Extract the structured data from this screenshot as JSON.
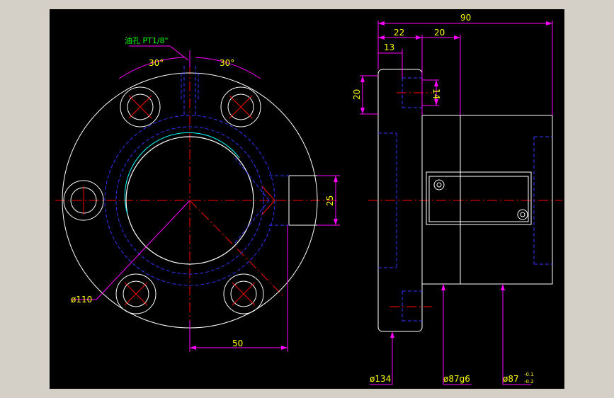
{
  "colors": {
    "background": "#d4d0c8",
    "canvas": "#000000",
    "outline": "#ffffff",
    "hidden": "#3333ff",
    "center": "#ff0000",
    "dimension": "#ff00ff",
    "dim_text": "#ffff00",
    "note": "#00ff00",
    "thread": "#00ffff"
  },
  "front_view": {
    "oil_hole_note": "油孔 PT1/8\"",
    "angle_left": "30°",
    "angle_right": "30°",
    "pitch_circle_dia": "ø110",
    "flat_height": "25",
    "flat_offset": "50"
  },
  "side_view": {
    "overall_length": "90",
    "flange_width": "22",
    "offset_20": "20",
    "offset_13": "13",
    "counterbore_dia": "20",
    "hole_dia": "14",
    "flange_dia": "ø134",
    "body_dia": "ø87g6",
    "shoulder_dia": "ø87",
    "tolerance_upper": "-0.1",
    "tolerance_lower": "-0.2"
  }
}
